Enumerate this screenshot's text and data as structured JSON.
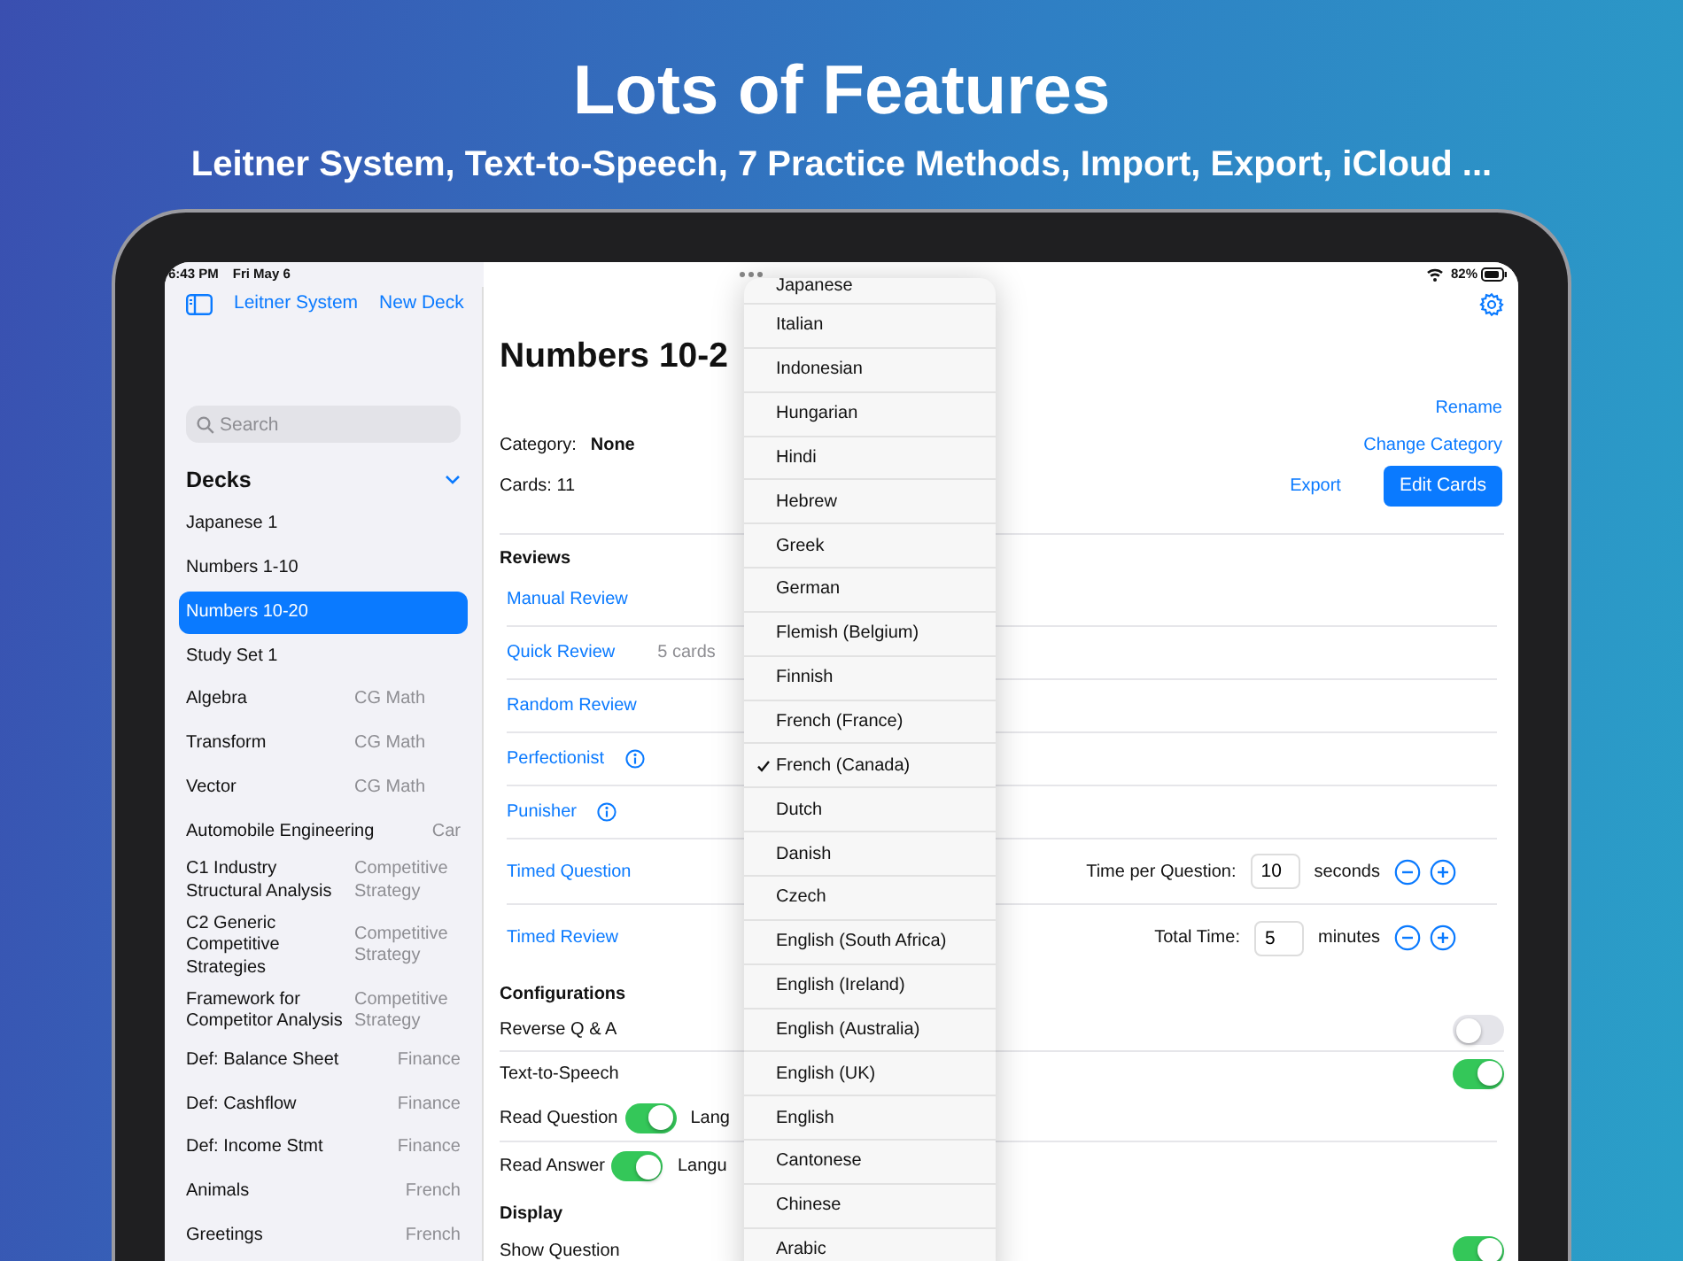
{
  "headline": "Lots of Features",
  "subtitle": "Leitner System, Text-to-Speech, 7 Practice Methods, Import, Export, iCloud ...",
  "status_bar": {
    "time": "6:43 PM",
    "date": "Fri May 6",
    "battery": "82%"
  },
  "sidebar": {
    "toolbar_links": [
      "Leitner System",
      "New Deck"
    ],
    "search": {
      "placeholder": "Search"
    },
    "section": {
      "title": "Decks",
      "expanded": true
    },
    "items": [
      {
        "title": "Japanese 1",
        "selected": false
      },
      {
        "title": "Numbers 1-10",
        "selected": false
      },
      {
        "title": "Numbers 10-20",
        "selected": true
      },
      {
        "title": "Study Set 1",
        "selected": false
      },
      {
        "title": "Algebra",
        "category": "CG Math",
        "selected": false
      },
      {
        "title": "Transform",
        "category": "CG Math",
        "selected": false
      },
      {
        "title": "Vector",
        "category": "CG Math",
        "selected": false
      },
      {
        "title": "Automobile Engineering",
        "category": "Car",
        "selected": false
      },
      {
        "title": "C1 Industry Structural Analysis",
        "category": "Competitive Strategy",
        "selected": false
      },
      {
        "title": "C2 Generic Competitive Strategies",
        "category": "Competitive Strategy",
        "selected": false
      },
      {
        "title": "Framework for Competitor Analysis",
        "category": "Competitive Strategy",
        "selected": false
      },
      {
        "title": "Def: Balance Sheet",
        "category": "Finance",
        "selected": false
      },
      {
        "title": "Def: Cashflow",
        "category": "Finance",
        "selected": false
      },
      {
        "title": "Def: Income Stmt",
        "category": "Finance",
        "selected": false
      },
      {
        "title": "Animals",
        "category": "French",
        "selected": false
      },
      {
        "title": "Greetings",
        "category": "French",
        "selected": false
      }
    ]
  },
  "detail": {
    "title": "Numbers 10-2",
    "rename": "Rename",
    "change_category": "Change Category",
    "category_label": "Category:",
    "category_value": "None",
    "cards": "Cards: 11",
    "export": "Export",
    "edit_button": "Edit Cards",
    "sections": [
      {
        "title": "Reviews",
        "rows": [
          {
            "kind": "link",
            "label": "Manual Review"
          },
          {
            "kind": "link",
            "label": "Quick Review",
            "note": "5 cards"
          },
          {
            "kind": "link",
            "label": "Random Review"
          },
          {
            "kind": "info",
            "label": "Perfectionist"
          },
          {
            "kind": "info",
            "label": "Punisher"
          },
          {
            "kind": "timer",
            "label": "Timed Question",
            "field_label": "Time per Question:",
            "value": "10",
            "unit": "seconds"
          },
          {
            "kind": "timer",
            "label": "Timed Review",
            "field_label": "Total Time:",
            "value": "5",
            "unit": "minutes"
          }
        ]
      },
      {
        "title": "Configurations",
        "rows": [
          {
            "kind": "toggle",
            "label": "Reverse Q & A",
            "on": false
          },
          {
            "kind": "toggle",
            "label": "Text-to-Speech",
            "on": true
          },
          {
            "kind": "subtoggle",
            "label": "Read Question",
            "on": true,
            "extra": "Lang"
          },
          {
            "kind": "subtoggle",
            "label": "Read Answer",
            "on": true,
            "extra": "Langu"
          }
        ]
      },
      {
        "title": "Display",
        "rows": [
          {
            "kind": "toggle",
            "label": "Show Question",
            "on": true
          }
        ]
      }
    ]
  },
  "language_menu": {
    "items": [
      {
        "label": "Japanese",
        "selected": false
      },
      {
        "label": "Italian",
        "selected": false
      },
      {
        "label": "Indonesian",
        "selected": false
      },
      {
        "label": "Hungarian",
        "selected": false
      },
      {
        "label": "Hindi",
        "selected": false
      },
      {
        "label": "Hebrew",
        "selected": false
      },
      {
        "label": "Greek",
        "selected": false
      },
      {
        "label": "German",
        "selected": false
      },
      {
        "label": "Flemish (Belgium)",
        "selected": false
      },
      {
        "label": "Finnish",
        "selected": false
      },
      {
        "label": "French (France)",
        "selected": false
      },
      {
        "label": "French (Canada)",
        "selected": true
      },
      {
        "label": "Dutch",
        "selected": false
      },
      {
        "label": "Danish",
        "selected": false
      },
      {
        "label": "Czech",
        "selected": false
      },
      {
        "label": "English (South Africa)",
        "selected": false
      },
      {
        "label": "English (Ireland)",
        "selected": false
      },
      {
        "label": "English (Australia)",
        "selected": false
      },
      {
        "label": "English (UK)",
        "selected": false
      },
      {
        "label": "English",
        "selected": false
      },
      {
        "label": "Cantonese",
        "selected": false
      },
      {
        "label": "Chinese",
        "selected": false
      },
      {
        "label": "Arabic",
        "selected": false
      }
    ]
  }
}
